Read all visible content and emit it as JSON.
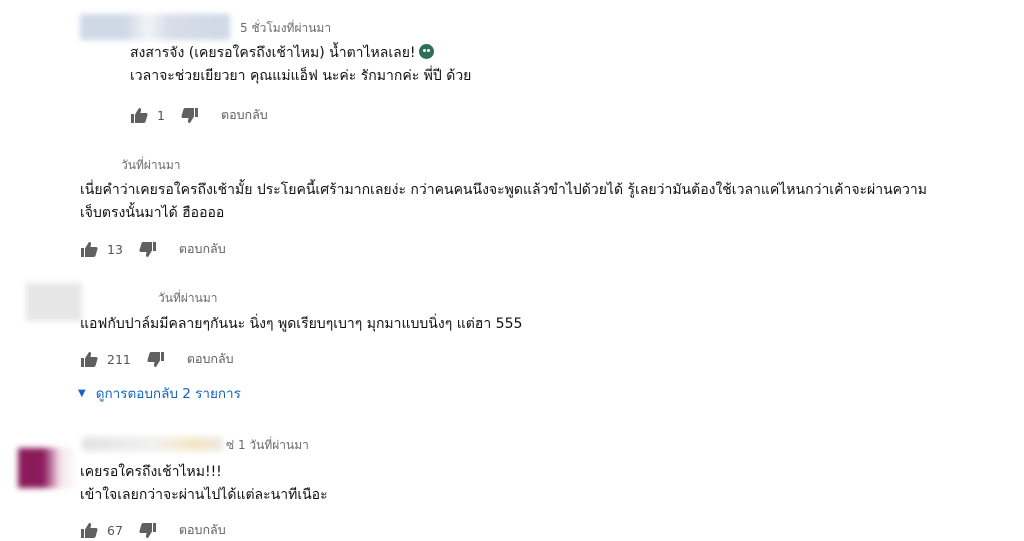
{
  "comments": [
    {
      "time": "5 ชั่วโมงที่ผ่านมา",
      "lines": [
        "สงสารจัง (เคยรอใครถึงเช้าไหม) น้ำตาไหลเลย!",
        "เวลาจะช่วยเยียวยา คุณแม่แอ็ฟ นะค่ะ รักมากค่ะ พี่ปี ด้วย"
      ],
      "emoji": "crying-face",
      "likes": "1",
      "reply_label": "ตอบกลับ"
    },
    {
      "time": "วันที่ผ่านมา",
      "lines": [
        "เนี่ยคำว่าเคยรอใครถึงเช้ามั้ย  ประโยคนี้เศร้ามากเลยง่ะ กว่าคนคนนึงจะพูดแล้วขำไปด้วยได้ รู้เลยว่ามันต้องใช้เวลาแค่ไหนกว่าเค้าจะผ่านความ",
        "เจ็บตรงนั้นมาได้ ฮืออออ"
      ],
      "likes": "13",
      "reply_label": "ตอบกลับ"
    },
    {
      "time": "วันที่ผ่านมา",
      "lines": [
        "แอฟกับปาล์มมีคลายๆกันนะ นิ่งๆ พูดเรียบๆเบาๆ มุกมาแบบนิ่งๆ แต่ฮา 555"
      ],
      "likes": "211",
      "reply_label": "ตอบกลับ",
      "view_replies": "ดูการตอบกลับ 2 รายการ"
    },
    {
      "time": "ซ่ 1 วันที่ผ่านมา",
      "lines": [
        "เคยรอใครถึงเช้าไหม!!!",
        "เข้าใจเลยกว่าจะผ่านไปได้แต่ละนาทีเนือะ"
      ],
      "likes": "67",
      "reply_label": "ตอบกลับ"
    }
  ],
  "colors": {
    "link": "#1565c0",
    "avatar_4": "#8b1a5a",
    "muted": "#6b6b6b"
  },
  "icons": [
    "thumb-up-icon",
    "thumb-down-icon",
    "caret-down-icon"
  ]
}
